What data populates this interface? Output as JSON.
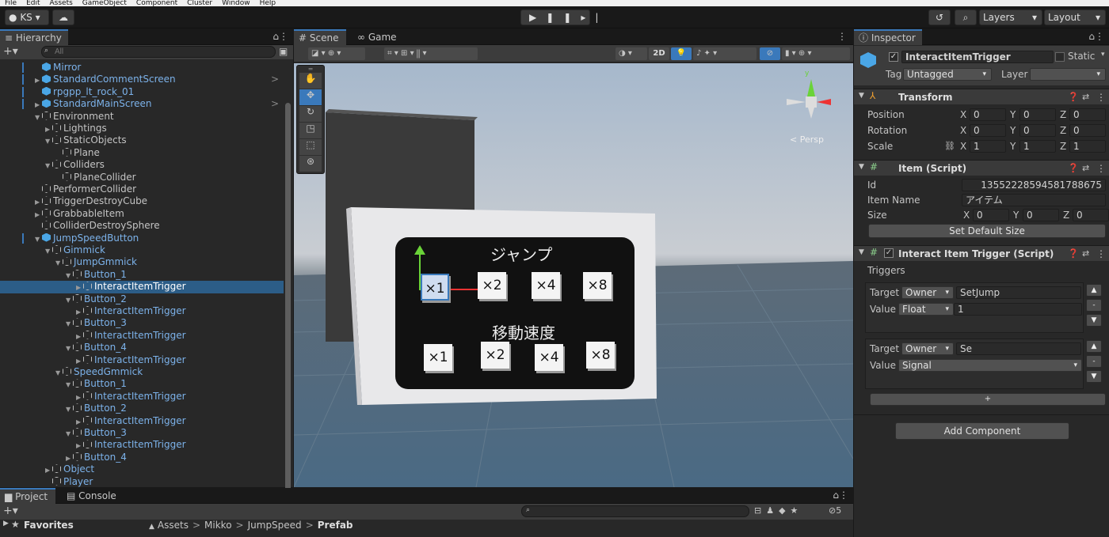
{
  "menubar": [
    "File",
    "Edit",
    "Assets",
    "GameObject",
    "Component",
    "Cluster",
    "Window",
    "Help"
  ],
  "toolbar": {
    "account": "KS",
    "layers": "Layers",
    "layout": "Layout"
  },
  "hierarchy": {
    "tab": "Hierarchy",
    "search_placeholder": "All",
    "rows": [
      {
        "label": "Mirror",
        "indent": 0,
        "icon": "prefab",
        "arrow": "",
        "blue": true
      },
      {
        "label": "StandardCommentScreen",
        "indent": 0,
        "icon": "prefab",
        "arrow": "▶",
        "blue": true
      },
      {
        "label": "rpgpp_lt_rock_01",
        "indent": 0,
        "icon": "prefab",
        "arrow": "",
        "blue": true
      },
      {
        "label": "StandardMainScreen",
        "indent": 0,
        "icon": "prefab",
        "arrow": "▶",
        "blue": true
      },
      {
        "label": "Environment",
        "indent": 0,
        "icon": "go",
        "arrow": "▼"
      },
      {
        "label": "Lightings",
        "indent": 1,
        "icon": "go",
        "arrow": "▶"
      },
      {
        "label": "StaticObjects",
        "indent": 1,
        "icon": "go",
        "arrow": "▼"
      },
      {
        "label": "Plane",
        "indent": 2,
        "icon": "go",
        "arrow": ""
      },
      {
        "label": "Colliders",
        "indent": 1,
        "icon": "go",
        "arrow": "▼"
      },
      {
        "label": "PlaneCollider",
        "indent": 2,
        "icon": "go",
        "arrow": ""
      },
      {
        "label": "PerformerCollider",
        "indent": 0,
        "icon": "go",
        "arrow": ""
      },
      {
        "label": "TriggerDestroyCube",
        "indent": 0,
        "icon": "go",
        "arrow": "▶"
      },
      {
        "label": "GrabbableItem",
        "indent": 0,
        "icon": "go",
        "arrow": "▶"
      },
      {
        "label": "ColliderDestroySphere",
        "indent": 0,
        "icon": "go",
        "arrow": ""
      },
      {
        "label": "JumpSpeedButton",
        "indent": 0,
        "icon": "prefab",
        "arrow": "▼",
        "blue": true
      },
      {
        "label": "Gimmick",
        "indent": 1,
        "icon": "go",
        "arrow": "▼",
        "blue": true
      },
      {
        "label": "JumpGmmick",
        "indent": 2,
        "icon": "go",
        "arrow": "▼",
        "blue": true
      },
      {
        "label": "Button_1",
        "indent": 3,
        "icon": "go",
        "arrow": "▼",
        "blue": true
      },
      {
        "label": "InteractItemTrigger",
        "indent": 4,
        "icon": "go",
        "arrow": "▶",
        "blue": true,
        "selected": true
      },
      {
        "label": "Button_2",
        "indent": 3,
        "icon": "go",
        "arrow": "▼",
        "blue": true
      },
      {
        "label": "InteractItemTrigger",
        "indent": 4,
        "icon": "go",
        "arrow": "▶",
        "blue": true
      },
      {
        "label": "Button_3",
        "indent": 3,
        "icon": "go",
        "arrow": "▼",
        "blue": true
      },
      {
        "label": "InteractItemTrigger",
        "indent": 4,
        "icon": "go",
        "arrow": "▶",
        "blue": true
      },
      {
        "label": "Button_4",
        "indent": 3,
        "icon": "go",
        "arrow": "▼",
        "blue": true
      },
      {
        "label": "InteractItemTrigger",
        "indent": 4,
        "icon": "go",
        "arrow": "▶",
        "blue": true
      },
      {
        "label": "SpeedGmmick",
        "indent": 2,
        "icon": "go",
        "arrow": "▼",
        "blue": true
      },
      {
        "label": "Button_1",
        "indent": 3,
        "icon": "go",
        "arrow": "▼",
        "blue": true
      },
      {
        "label": "InteractItemTrigger",
        "indent": 4,
        "icon": "go",
        "arrow": "▶",
        "blue": true
      },
      {
        "label": "Button_2",
        "indent": 3,
        "icon": "go",
        "arrow": "▼",
        "blue": true
      },
      {
        "label": "InteractItemTrigger",
        "indent": 4,
        "icon": "go",
        "arrow": "▶",
        "blue": true
      },
      {
        "label": "Button_3",
        "indent": 3,
        "icon": "go",
        "arrow": "▼",
        "blue": true
      },
      {
        "label": "InteractItemTrigger",
        "indent": 4,
        "icon": "go",
        "arrow": "▶",
        "blue": true
      },
      {
        "label": "Button_4",
        "indent": 3,
        "icon": "go",
        "arrow": "▶",
        "blue": true
      },
      {
        "label": "Object",
        "indent": 1,
        "icon": "go",
        "arrow": "▶",
        "blue": true
      },
      {
        "label": "Player",
        "indent": 1,
        "icon": "go",
        "arrow": "",
        "blue": true
      }
    ]
  },
  "scene": {
    "tabs": [
      "Scene",
      "Game"
    ],
    "toggle_2d": "2D",
    "persp": "< Persp",
    "screen": {
      "jump_title": "ジャンプ",
      "speed_title": "移動速度",
      "buttons": [
        "×1",
        "×2",
        "×4",
        "×8"
      ]
    }
  },
  "inspector": {
    "tab": "Inspector",
    "object_name": "InteractItemTrigger",
    "static": "Static",
    "tag_label": "Tag",
    "tag_value": "Untagged",
    "layer_label": "Layer",
    "layer_value": "",
    "transform": {
      "title": "Transform",
      "rows": [
        {
          "label": "Position",
          "x": "0",
          "y": "0",
          "z": "0"
        },
        {
          "label": "Rotation",
          "x": "0",
          "y": "0",
          "z": "0"
        },
        {
          "label": "Scale",
          "x": "1",
          "y": "1",
          "z": "1"
        }
      ]
    },
    "item": {
      "title": "Item (Script)",
      "id_label": "Id",
      "id_value": "13552228594581788675",
      "name_label": "Item Name",
      "name_value": "アイテム",
      "size_label": "Size",
      "size": {
        "x": "0",
        "y": "0",
        "z": "0"
      },
      "default_button": "Set Default Size"
    },
    "trigger": {
      "title": "Interact Item Trigger (Script)",
      "triggers_label": "Triggers",
      "entries": [
        {
          "target_label": "Target",
          "target": "Owner",
          "key": "SetJump",
          "value_label": "Value",
          "value_type": "Float",
          "value": "1"
        },
        {
          "target_label": "Target",
          "target": "Owner",
          "key": "Se",
          "value_label": "Value",
          "value_type": "Signal",
          "value": ""
        }
      ],
      "add_button": "+"
    },
    "add_component": "Add Component",
    "axis": {
      "x": "X",
      "y": "Y",
      "z": "Z"
    }
  },
  "bottom": {
    "tabs": [
      "Project",
      "Console"
    ],
    "favorites": "Favorites",
    "breadcrumb": [
      "Assets",
      "Mikko",
      "JumpSpeed",
      "Prefab"
    ],
    "hidden_count": "5"
  }
}
